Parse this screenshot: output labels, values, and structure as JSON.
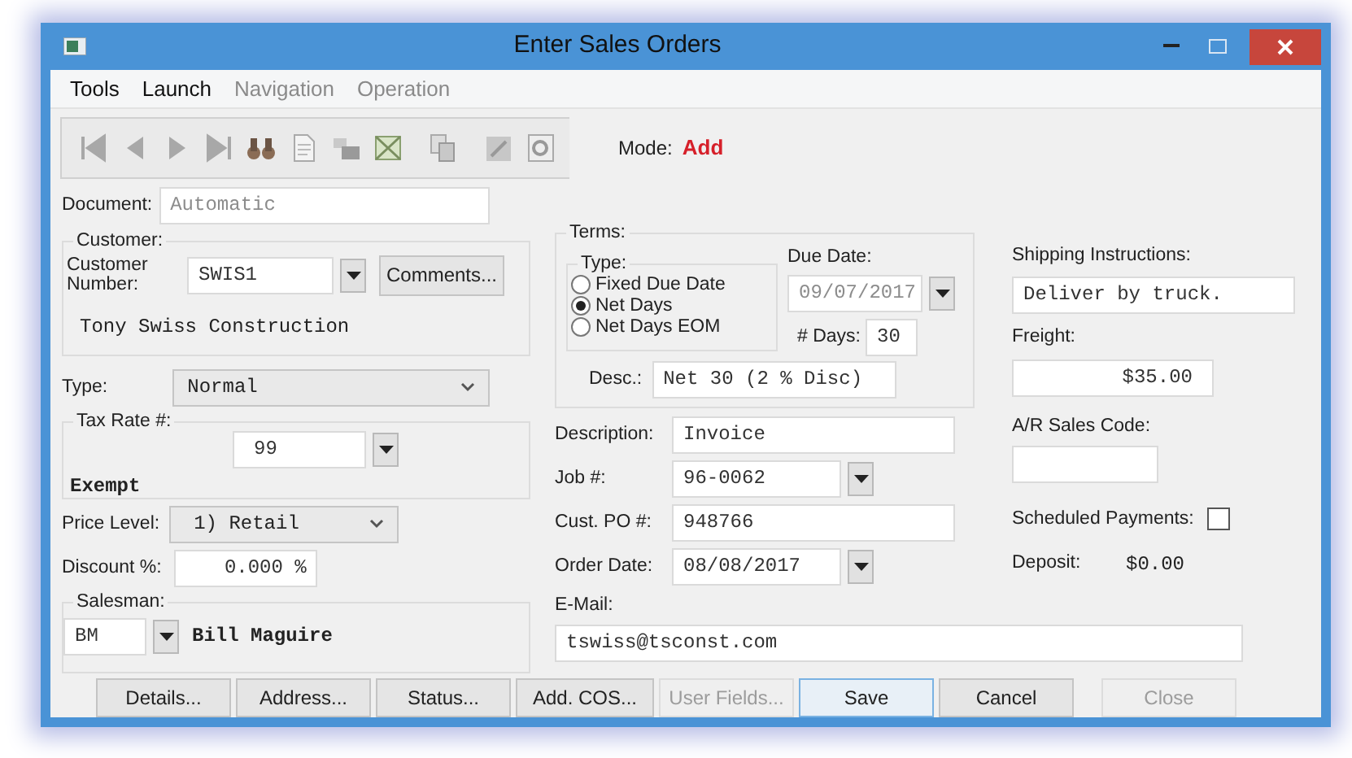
{
  "window": {
    "title": "Enter Sales Orders"
  },
  "menu": [
    {
      "label": "Tools",
      "disabled": false
    },
    {
      "label": "Launch",
      "disabled": false
    },
    {
      "label": "Navigation",
      "disabled": true
    },
    {
      "label": "Operation",
      "disabled": true
    }
  ],
  "mode": {
    "label": "Mode:",
    "value": "Add"
  },
  "document": {
    "label": "Document:",
    "value": "Automatic",
    "disabled": true
  },
  "customer": {
    "group": "Customer:",
    "label": "Customer Number:",
    "value": "SWIS1",
    "button": "Comments...",
    "name": "Tony Swiss Construction"
  },
  "type": {
    "label": "Type:",
    "value": "Normal"
  },
  "tax_rate": {
    "group": "Tax Rate #:",
    "value": "99",
    "status": "Exempt"
  },
  "price_level": {
    "label": "Price Level:",
    "value": "1) Retail"
  },
  "discount": {
    "label": "Discount %:",
    "value": "0.000 %"
  },
  "salesman": {
    "group": "Salesman:",
    "code": "BM",
    "name": "Bill Maguire"
  },
  "terms": {
    "group": "Terms:",
    "type_label": "Type:",
    "options": [
      {
        "label": "Fixed Due Date",
        "selected": false
      },
      {
        "label": "Net Days",
        "selected": true
      },
      {
        "label": "Net Days EOM",
        "selected": false
      }
    ],
    "due_date_label": "Due Date:",
    "due_date": "09/07/2017",
    "due_date_disabled": true,
    "days_label": "# Days:",
    "days": "30",
    "desc_label": "Desc.:",
    "desc": "Net 30 (2 % Disc)"
  },
  "fields": [
    {
      "label": "Description:",
      "value": "Invoice",
      "kind": "text"
    },
    {
      "label": "Job #:",
      "value": "96-0062",
      "kind": "combo"
    },
    {
      "label": "Cust. PO #:",
      "value": "948766",
      "kind": "text"
    },
    {
      "label": "Order Date:",
      "value": "08/08/2017",
      "kind": "combo"
    }
  ],
  "email": {
    "label": "E-Mail:",
    "value": "tswiss@tsconst.com"
  },
  "shipping": {
    "label": "Shipping Instructions:",
    "value": "Deliver by truck."
  },
  "freight": {
    "label": "Freight:",
    "value": "$35.00"
  },
  "ar_sales_code": {
    "label": "A/R Sales Code:"
  },
  "scheduled_payments": {
    "label": "Scheduled Payments:",
    "checked": false
  },
  "deposit": {
    "label": "Deposit:",
    "value": "$0.00"
  },
  "buttons": [
    {
      "label": "Details...",
      "disabled": false,
      "default": false
    },
    {
      "label": "Address...",
      "disabled": false,
      "default": false
    },
    {
      "label": "Status...",
      "disabled": false,
      "default": false
    },
    {
      "label": "Add. COS...",
      "disabled": false,
      "default": false
    },
    {
      "label": "User Fields...",
      "disabled": true,
      "default": false
    },
    {
      "label": "Save",
      "disabled": false,
      "default": true
    },
    {
      "label": "Cancel",
      "disabled": false,
      "default": false
    },
    {
      "label": "Close",
      "disabled": true,
      "default": false
    }
  ]
}
